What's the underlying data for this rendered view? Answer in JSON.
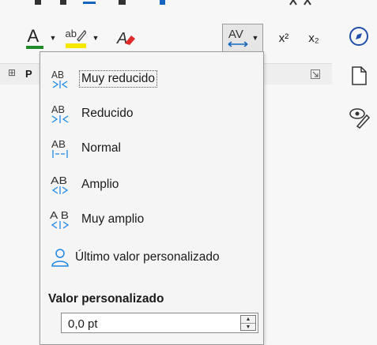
{
  "toolbar": {
    "font_color_letter": "A",
    "highlight_letters": "ab",
    "spacing_letters": "AV",
    "superscript_label": "x²",
    "subscript_label": "x₂",
    "panel_label": "P",
    "expand_symbol": "⊞",
    "colors": {
      "font_color": "#1f8a2a",
      "highlight": "#f7e600",
      "clear_format": "#e02a2a",
      "accent": "#1565c0"
    }
  },
  "spacing_menu": {
    "items": [
      {
        "label": "Muy reducido",
        "icon": "character-spacing-very-tight-icon",
        "highlighted": true
      },
      {
        "label": "Reducido",
        "icon": "character-spacing-tight-icon"
      },
      {
        "label": "Normal",
        "icon": "character-spacing-normal-icon"
      },
      {
        "label": "Amplio",
        "icon": "character-spacing-loose-icon"
      },
      {
        "label": "Muy amplio",
        "icon": "character-spacing-very-loose-icon"
      },
      {
        "label": "Último valor personalizado",
        "icon": "user-icon"
      }
    ],
    "custom_title": "Valor personalizado",
    "custom_value": "0,0 pt"
  }
}
